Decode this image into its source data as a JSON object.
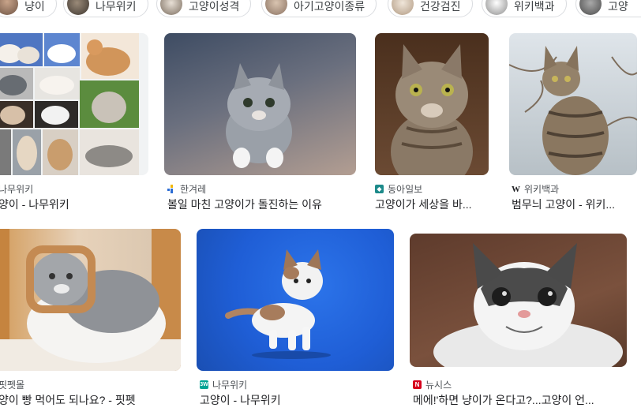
{
  "chips": [
    {
      "label": "냥이",
      "icon": "cat-thumbnail-icon"
    },
    {
      "label": "나무위키",
      "icon": "cat-thumbnail-icon"
    },
    {
      "label": "고양이성격",
      "icon": "cat-thumbnail-icon"
    },
    {
      "label": "아기고양이종류",
      "icon": "cat-thumbnail-icon"
    },
    {
      "label": "건강검진",
      "icon": "cat-thumbnail-icon"
    },
    {
      "label": "위키백과",
      "icon": "cat-thumbnail-icon"
    },
    {
      "label": "고양",
      "icon": "cat-thumbnail-icon"
    }
  ],
  "results": [
    {
      "source": "나무위키",
      "title": "양이 - 나무위키",
      "favicon": "namuwiki-icon"
    },
    {
      "source": "한겨레",
      "title": "볼일 마친 고양이가 돌진하는 이유",
      "favicon": "hani-icon"
    },
    {
      "source": "동아일보",
      "title": "고양이가 세상을 바...",
      "favicon": "donga-icon"
    },
    {
      "source": "위키백과",
      "title": "범무늬 고양이 - 위키...",
      "favicon": "wikipedia-icon",
      "favicon_text": "W"
    },
    {
      "source": "핏펫몰",
      "title": "양이 빵 먹어도 되나요? - 핏펫",
      "favicon": "fitpet-icon"
    },
    {
      "source": "나무위키",
      "title": "고양이 - 나무위키",
      "favicon": "namuwiki-icon",
      "favicon_text": "3W"
    },
    {
      "source": "뉴시스",
      "title": "메에!'하면 냥이가 온다고?...고양이 언...",
      "favicon": "newsis-icon",
      "favicon_text": "N"
    }
  ],
  "colors": {
    "namuwiki": "#00a495",
    "donga": "#1c8a8a",
    "newsis": "#d6001c",
    "hani_blue": "#2b6cd4",
    "hani_yellow": "#f2b705",
    "bg_blue": "#1f5ed6"
  }
}
